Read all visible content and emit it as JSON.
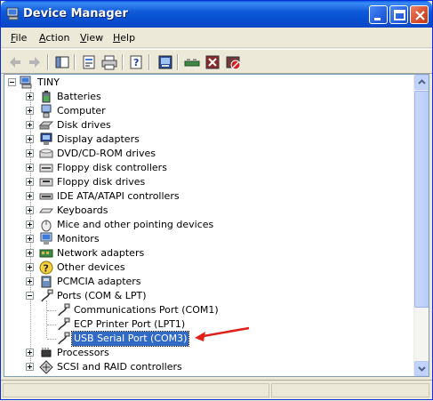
{
  "window": {
    "title": "Device Manager",
    "title_icon": "computer-icon"
  },
  "menu": [
    {
      "label": "File",
      "key": "F",
      "rest": "ile"
    },
    {
      "label": "Action",
      "key": "A",
      "rest": "ction"
    },
    {
      "label": "View",
      "key": "V",
      "rest": "iew"
    },
    {
      "label": "Help",
      "key": "H",
      "rest": "elp"
    }
  ],
  "toolbar": [
    "back-arrow-icon",
    "forward-arrow-icon",
    "show-hide-console-tree-icon",
    "properties-icon",
    "print-icon",
    "help-icon",
    "computer-view-icon",
    "scan-hardware-icon",
    "uninstall-icon",
    "disable-device-icon"
  ],
  "tree": {
    "root": "TINY",
    "categories": [
      {
        "label": "Batteries",
        "icon": "battery-icon"
      },
      {
        "label": "Computer",
        "icon": "computer-icon"
      },
      {
        "label": "Disk drives",
        "icon": "disk-drive-icon"
      },
      {
        "label": "Display adapters",
        "icon": "display-adapter-icon"
      },
      {
        "label": "DVD/CD-ROM drives",
        "icon": "cdrom-icon"
      },
      {
        "label": "Floppy disk controllers",
        "icon": "floppy-controller-icon"
      },
      {
        "label": "Floppy disk drives",
        "icon": "floppy-drive-icon"
      },
      {
        "label": "IDE ATA/ATAPI controllers",
        "icon": "ide-controller-icon"
      },
      {
        "label": "Keyboards",
        "icon": "keyboard-icon"
      },
      {
        "label": "Mice and other pointing devices",
        "icon": "mouse-icon"
      },
      {
        "label": "Monitors",
        "icon": "monitor-icon"
      },
      {
        "label": "Network adapters",
        "icon": "network-adapter-icon"
      },
      {
        "label": "Other devices",
        "icon": "unknown-device-icon"
      },
      {
        "label": "PCMCIA adapters",
        "icon": "pcmcia-icon"
      },
      {
        "label": "Ports (COM & LPT)",
        "icon": "port-icon",
        "expanded": true,
        "children": [
          {
            "label": "Communications Port (COM1)",
            "icon": "port-icon"
          },
          {
            "label": "ECP Printer Port (LPT1)",
            "icon": "port-icon"
          },
          {
            "label": "USB Serial Port (COM3)",
            "icon": "port-icon",
            "selected": true
          }
        ]
      },
      {
        "label": "Processors",
        "icon": "processor-icon"
      },
      {
        "label": "SCSI and RAID controllers",
        "icon": "scsi-controller-icon"
      }
    ]
  },
  "colors": {
    "title_bar": "#0a5ee6",
    "selection": "#316ac5",
    "annotation_arrow": "#e0201a"
  }
}
